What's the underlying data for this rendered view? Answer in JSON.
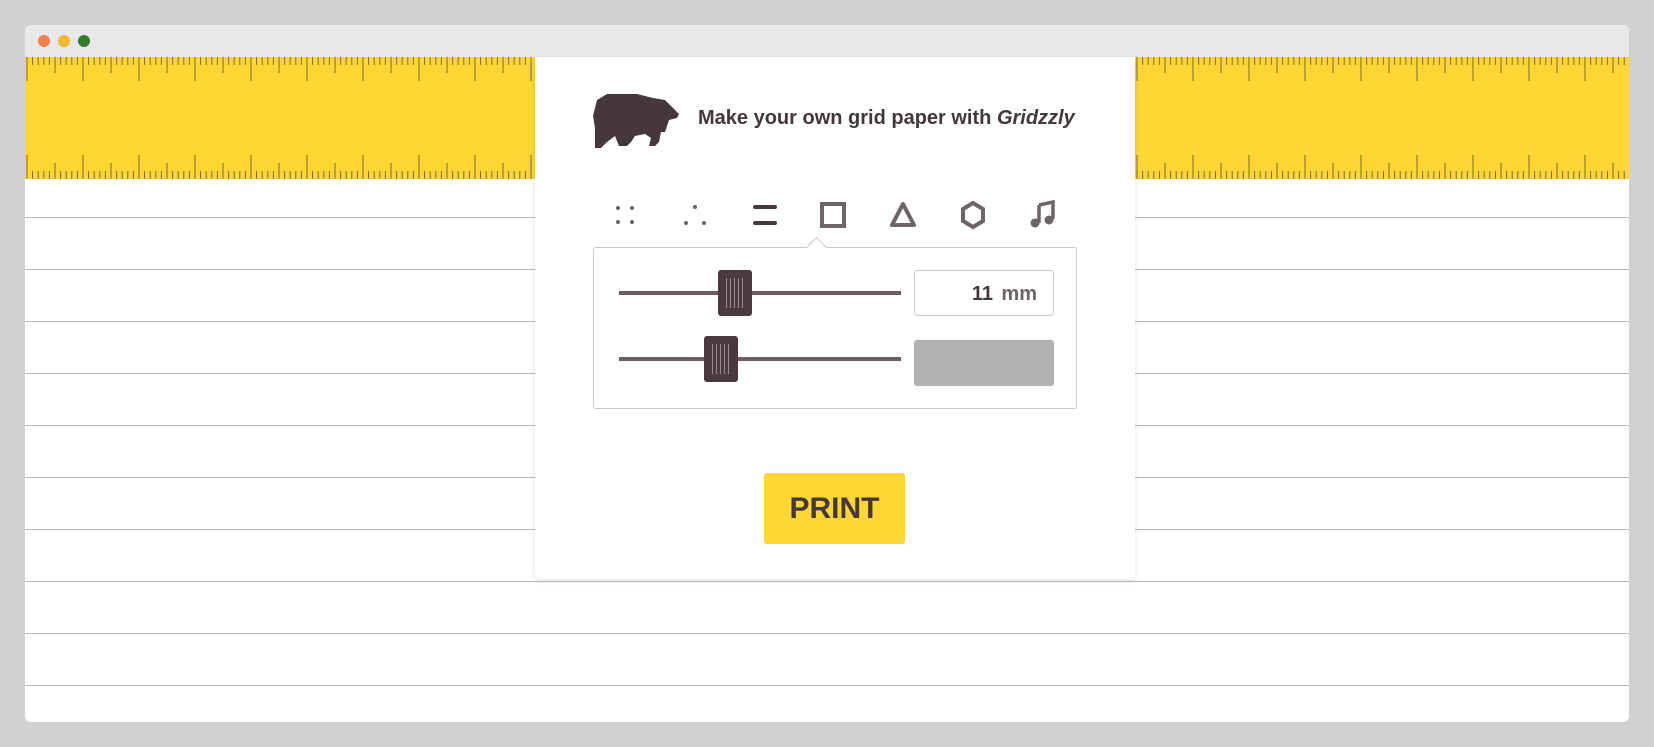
{
  "window": {
    "controls": [
      "close",
      "minimize",
      "maximize"
    ]
  },
  "header": {
    "logo_icon": "bear-icon",
    "title_prefix": "Make your own grid paper with ",
    "title_brand": "Gridzzly"
  },
  "patterns": [
    {
      "name": "square-dots",
      "icon": "dots-grid-icon",
      "selected": false
    },
    {
      "name": "triangle-dots",
      "icon": "dots-triangle-icon",
      "selected": false
    },
    {
      "name": "lines",
      "icon": "lines-icon",
      "selected": true
    },
    {
      "name": "squares",
      "icon": "square-icon",
      "selected": false
    },
    {
      "name": "triangles",
      "icon": "triangle-icon",
      "selected": false
    },
    {
      "name": "hexagons",
      "icon": "hexagon-icon",
      "selected": false
    },
    {
      "name": "music",
      "icon": "music-note-icon",
      "selected": false
    }
  ],
  "settings": {
    "spacing_slider_level": 0.41,
    "spacing_value": "11",
    "spacing_unit": "mm",
    "second_slider_level": 0.36,
    "second_value_disabled": true
  },
  "actions": {
    "print_label": "PRINT"
  },
  "colors": {
    "accent_yellow": "#ffd633",
    "text_dark": "#45373a",
    "page_bg": "#d1d1d1",
    "disabled_gray": "#b2b2b2"
  }
}
